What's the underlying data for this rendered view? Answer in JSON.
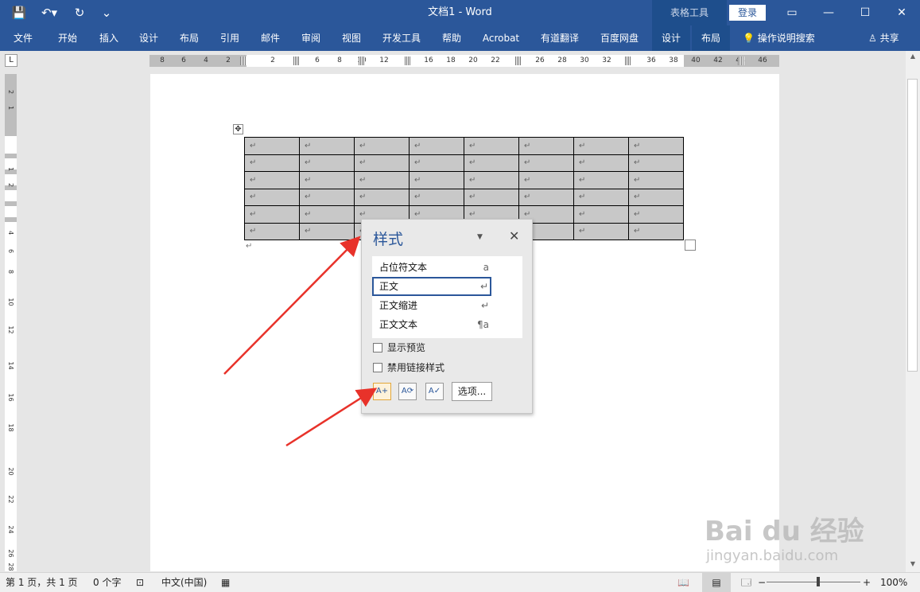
{
  "title_bar": {
    "doc_title": "文档1  -  Word",
    "context_tools": "表格工具",
    "login": "登录",
    "qat_icons": [
      "save-icon",
      "undo-icon",
      "redo-icon",
      "customize-icon"
    ],
    "qat_glyphs": [
      "💾",
      "↶▾",
      "↻",
      "⌄"
    ],
    "window_controls": [
      "▭",
      "—",
      "☐",
      "✕"
    ]
  },
  "ribbon": {
    "tabs": [
      "文件",
      "开始",
      "插入",
      "设计",
      "布局",
      "引用",
      "邮件",
      "审阅",
      "视图",
      "开发工具",
      "帮助",
      "Acrobat",
      "有道翻译",
      "百度网盘",
      "设计",
      "布局"
    ],
    "search_hint": "💡 操作说明搜索",
    "share": "♙ 共享"
  },
  "ruler": {
    "corner": "L",
    "h_labels": [
      "8",
      "6",
      "4",
      "2",
      "2",
      "6",
      "8",
      "10",
      "12",
      "16",
      "18",
      "20",
      "22",
      "26",
      "28",
      "30",
      "32",
      "36",
      "38",
      "40",
      "42",
      "44",
      "46"
    ],
    "v_labels": [
      "2",
      "1",
      "1",
      "2",
      "4",
      "6",
      "8",
      "10",
      "12",
      "14",
      "16",
      "18",
      "20",
      "22",
      "24",
      "26",
      "28"
    ]
  },
  "document": {
    "table_rows": 6,
    "table_cols": 8,
    "cell_mark": "↵",
    "move_handle": "✥",
    "para_mark": "↵"
  },
  "styles_pane": {
    "title": "样式",
    "menu_glyph": "▼",
    "close_glyph": "✕",
    "items": [
      {
        "label": "占位符文本",
        "mark": "a"
      },
      {
        "label": "正文",
        "mark": "↵"
      },
      {
        "label": "正文缩进",
        "mark": "↵"
      },
      {
        "label": "正文文本",
        "mark": "¶a"
      }
    ],
    "selected_index": 1,
    "show_preview": "显示预览",
    "disable_linked": "禁用链接样式",
    "buttons": [
      {
        "icon": "new-style-icon",
        "glyph": "A+"
      },
      {
        "icon": "style-inspector-icon",
        "glyph": "A⟳"
      },
      {
        "icon": "manage-styles-icon",
        "glyph": "A✓"
      }
    ],
    "options": "选项..."
  },
  "status_bar": {
    "page": "第 1 页，共 1 页",
    "words": "0 个字",
    "proof_icon": "proofing-icon",
    "language": "中文(中国)",
    "macro_icon": "macro-icon",
    "view_icons": [
      "read-mode-icon",
      "print-layout-icon",
      "web-layout-icon"
    ],
    "zoom_minus": "−",
    "zoom_plus": "+",
    "zoom": "100%",
    "zoom_level": 1.0
  },
  "watermark": {
    "brand": "Bai du 经验",
    "url": "jingyan.baidu.com"
  },
  "colors": {
    "ribbon": "#2b579a",
    "arrow": "#e8322a",
    "cell_shading": "#c8c8c8"
  }
}
